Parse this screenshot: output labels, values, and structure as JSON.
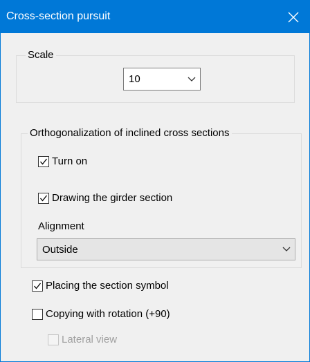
{
  "window": {
    "title": "Cross-section pursuit"
  },
  "scale": {
    "legend": "Scale",
    "value": "10"
  },
  "orthogonalization": {
    "legend": "Orthogonalization of inclined cross sections",
    "turn_on": {
      "label": "Turn on",
      "checked": true
    },
    "drawing_girder": {
      "label": "Drawing the girder section",
      "checked": true
    },
    "alignment_label": "Alignment",
    "alignment_value": "Outside"
  },
  "placing_symbol": {
    "label": "Placing the section symbol",
    "checked": true
  },
  "copying_rotation": {
    "label": "Copying with rotation (+90)",
    "checked": false
  },
  "lateral_view": {
    "label": "Lateral view",
    "checked": false,
    "enabled": false
  },
  "colors": {
    "title_bar": "#0078d7",
    "background": "#f0f0f0"
  },
  "icons": {
    "close": "close-icon",
    "dropdown": "chevron-down-icon",
    "check": "checkmark-icon"
  }
}
